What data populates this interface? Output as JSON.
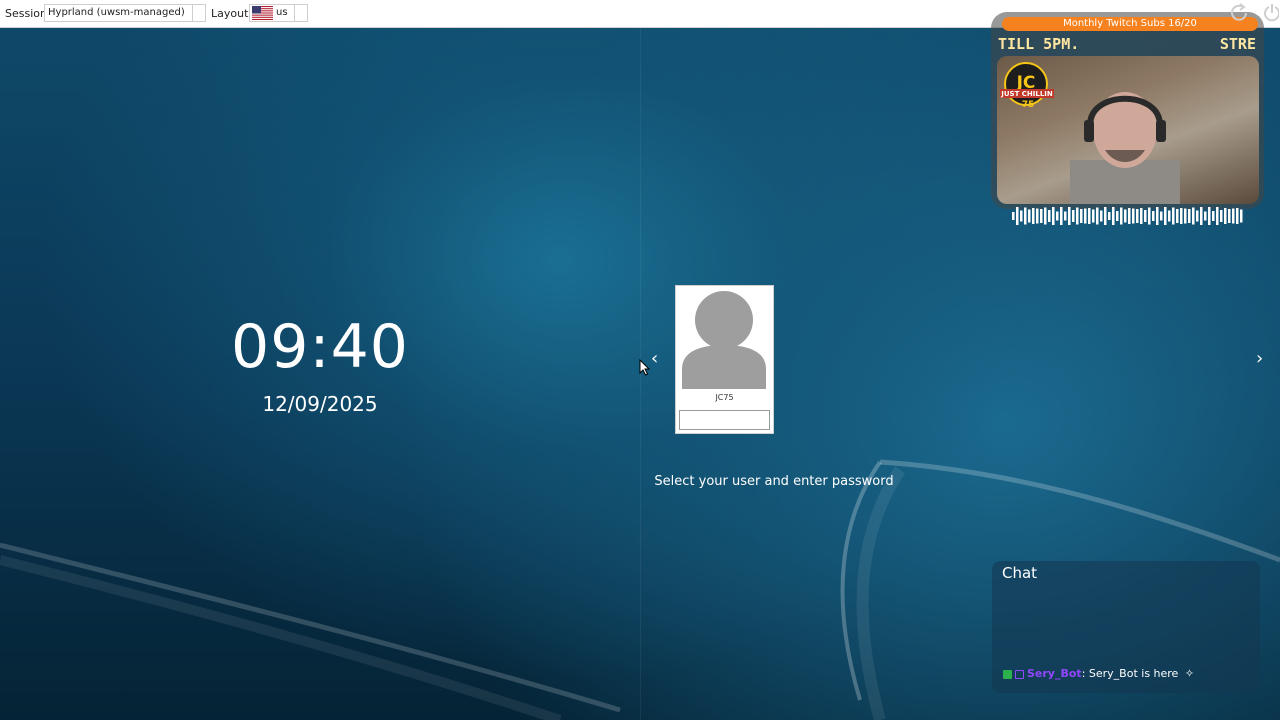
{
  "topbar": {
    "session_label": "Session",
    "session_value": "Hyprland (uwsm-managed)",
    "layout_label": "Layout",
    "layout_value": "us"
  },
  "clock": {
    "time": "09:40",
    "date": "12/09/2025"
  },
  "login": {
    "user_name": "JC75",
    "password_value": "",
    "prompt": "Select your user and enter password",
    "prev_icon": "chevron-left-icon",
    "next_icon": "chevron-right-icon"
  },
  "stream_overlay": {
    "subs_goal": "Monthly Twitch Subs 16/20",
    "marquee_left": "TILL 5PM.",
    "marquee_right": "STRE",
    "logo_text": "JC",
    "logo_sub": "JUST CHILLIN",
    "logo_num": "75"
  },
  "chat": {
    "title": "Chat",
    "messages": [
      {
        "user": "Sery_Bot",
        "text": ": Sery_Bot is here"
      }
    ]
  },
  "colors": {
    "accent_orange": "#f5821f",
    "chat_user": "#9147ff"
  }
}
